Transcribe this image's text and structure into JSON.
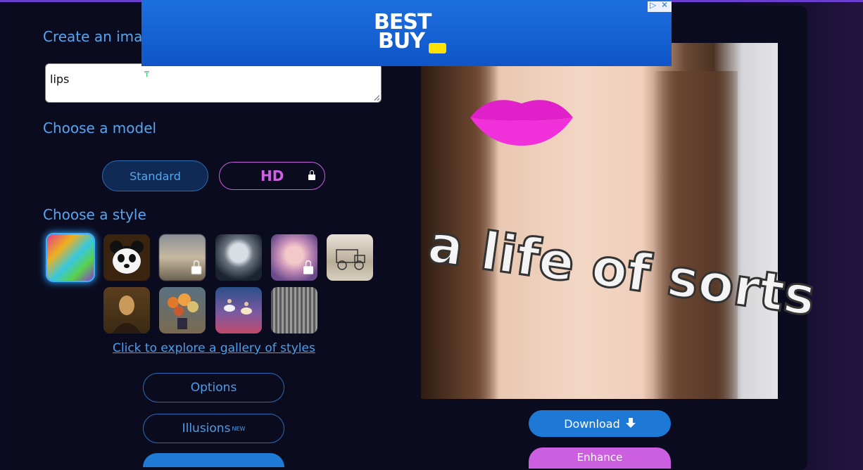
{
  "labels": {
    "create": "Create an image",
    "model": "Choose a model",
    "style": "Choose a style"
  },
  "prompt": {
    "value": "lips"
  },
  "models": {
    "standard": "Standard",
    "hd": "HD"
  },
  "styles": {
    "row1": [
      "abstract-paint",
      "panda",
      "blurred-city-locked",
      "robot",
      "anime-girl-locked",
      "vintage-car-sketch"
    ],
    "row2": [
      "mona-lisa",
      "flower-still-life",
      "ballet-dancers",
      "city-sketch"
    ],
    "gallery_link": "Click to explore a gallery of styles"
  },
  "buttons": {
    "options": "Options",
    "illusions": "Illusions",
    "illusions_badge": "NEW",
    "download": "Download",
    "enhance": "Enhance"
  },
  "ad": {
    "brand_line1": "BEST",
    "brand_line2": "BUY",
    "brand_color": "#1d6fe0"
  },
  "image": {
    "overlay_text": "a life of sorts"
  },
  "colors": {
    "accent": "#1d78d6",
    "hd": "#cc5fe0",
    "text": "#56a6f0"
  }
}
